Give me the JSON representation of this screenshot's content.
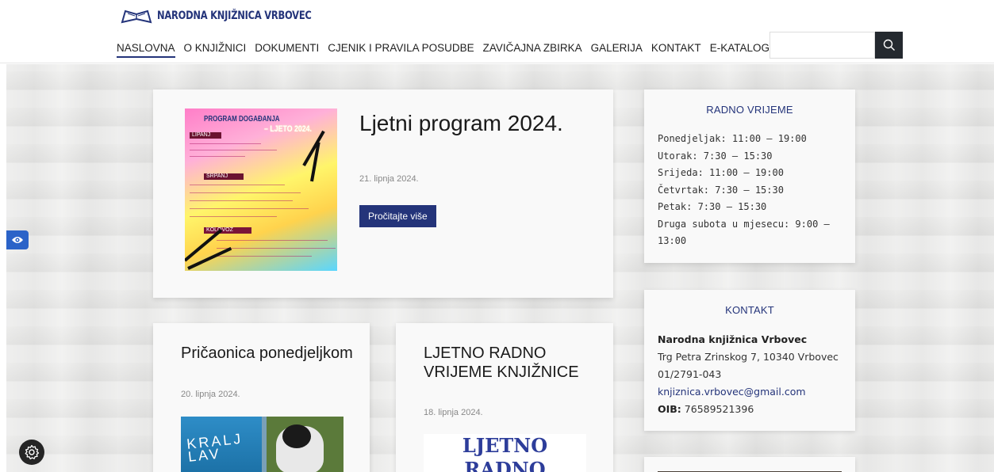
{
  "site": {
    "logo_text": "NARODNA KNJIŽNICA VRBOVEC"
  },
  "nav": {
    "items": [
      {
        "label": "NASLOVNA"
      },
      {
        "label": "O KNJIŽNICI"
      },
      {
        "label": "DOKUMENTI"
      },
      {
        "label": "CJENIK I PRAVILA POSUDBE"
      },
      {
        "label": "ZAVIČAJNA ZBIRKA"
      },
      {
        "label": "GALERIJA"
      },
      {
        "label": "KONTAKT"
      },
      {
        "label": "E-KATALOG"
      }
    ],
    "search_placeholder": "",
    "search_icon": "search-icon"
  },
  "posts": {
    "main": {
      "title": "Ljetni program 2024.",
      "date": "21. lipnja 2024.",
      "button": "Pročitajte više",
      "poster": {
        "title": "PROGRAM DOGAĐANJA",
        "subtitle": "– LJETO 2024.",
        "months": [
          "LIPANJ",
          "SRPANJ",
          "KOLOVOZ"
        ]
      }
    },
    "second": {
      "title": "Pričaonica ponedjeljkom",
      "date": "20. lipnja 2024.",
      "book_title": "KRALJ LAV"
    },
    "third": {
      "title": "LJETNO RADNO VRIJEME KNJIŽNICE",
      "date": "18. lipnja 2024.",
      "image_text_1": "LJETNO",
      "image_text_2": "RADNO"
    }
  },
  "sidebar": {
    "hours": {
      "heading": "RADNO VRIJEME",
      "lines": [
        "Ponedjeljak: 11:00 – 19:00",
        "Utorak: 7:30 – 15:30",
        "Srijeda: 11:00 – 19:00",
        "Četvrtak: 7:30 – 15:30",
        "Petak: 7:30 – 15:30",
        "Druga subota u mjesecu: 9:00 –",
        "13:00"
      ]
    },
    "contact": {
      "heading": "KONTAKT",
      "name": "Narodna knjižnica Vrbovec",
      "address": "Trg Petra Zrinskog 7, 10340 Vrbovec",
      "phone": "01/2791-043",
      "email": "knjiznica.vrbovec@gmail.com",
      "oib_label": "OIB:",
      "oib_value": "76589521396"
    }
  },
  "colors": {
    "brand": "#24347a",
    "accessibility": "#2b63c8"
  }
}
